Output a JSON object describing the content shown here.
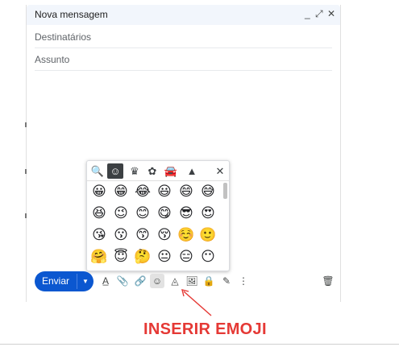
{
  "compose": {
    "title": "Nova mensagem",
    "controls": {
      "minimize": "_",
      "expand": "⤢",
      "close": "✕"
    },
    "to_placeholder": "Destinatários",
    "subject_placeholder": "Assunto"
  },
  "emoji_picker": {
    "tabs": [
      {
        "name": "search-icon",
        "glyph": "🔍"
      },
      {
        "name": "smiley-tab-icon",
        "glyph": "☺"
      },
      {
        "name": "crown-tab-icon",
        "glyph": "♛"
      },
      {
        "name": "flower-tab-icon",
        "glyph": "✿"
      },
      {
        "name": "car-tab-icon",
        "glyph": "🚘"
      },
      {
        "name": "triangle-tab-icon",
        "glyph": "▲"
      },
      {
        "name": "close-icon",
        "glyph": "✕"
      }
    ],
    "emojis": [
      [
        "😀",
        "😁",
        "😂",
        "😃",
        "😄",
        "😅"
      ],
      [
        "😆",
        "😉",
        "😊",
        "😋",
        "😎",
        "😍"
      ],
      [
        "😘",
        "😗",
        "😙",
        "😚",
        "☺️",
        "🙂"
      ],
      [
        "🤗",
        "😇",
        "🤔",
        "😐",
        "😑",
        "😶"
      ]
    ]
  },
  "toolbar": {
    "send_label": "Enviar",
    "send_dropdown": "▼",
    "icons": [
      {
        "name": "text-format-icon",
        "glyph": "A̲"
      },
      {
        "name": "attach-icon",
        "glyph": "📎"
      },
      {
        "name": "link-icon",
        "glyph": "🔗"
      },
      {
        "name": "emoji-icon",
        "glyph": "☺"
      },
      {
        "name": "drive-icon",
        "glyph": "◬"
      },
      {
        "name": "photo-icon",
        "glyph": "🖼"
      },
      {
        "name": "confidential-lock-icon",
        "glyph": "🔒"
      },
      {
        "name": "signature-pen-icon",
        "glyph": "✎"
      },
      {
        "name": "more-options-icon",
        "glyph": "⋮"
      },
      {
        "name": "trash-icon",
        "glyph": "🗑"
      }
    ]
  },
  "annotation": {
    "caption": "INSERIR EMOJI",
    "color": "#e53935"
  },
  "colors": {
    "send_button": "#0b57d0",
    "title_bar": "#f2f6fc"
  }
}
